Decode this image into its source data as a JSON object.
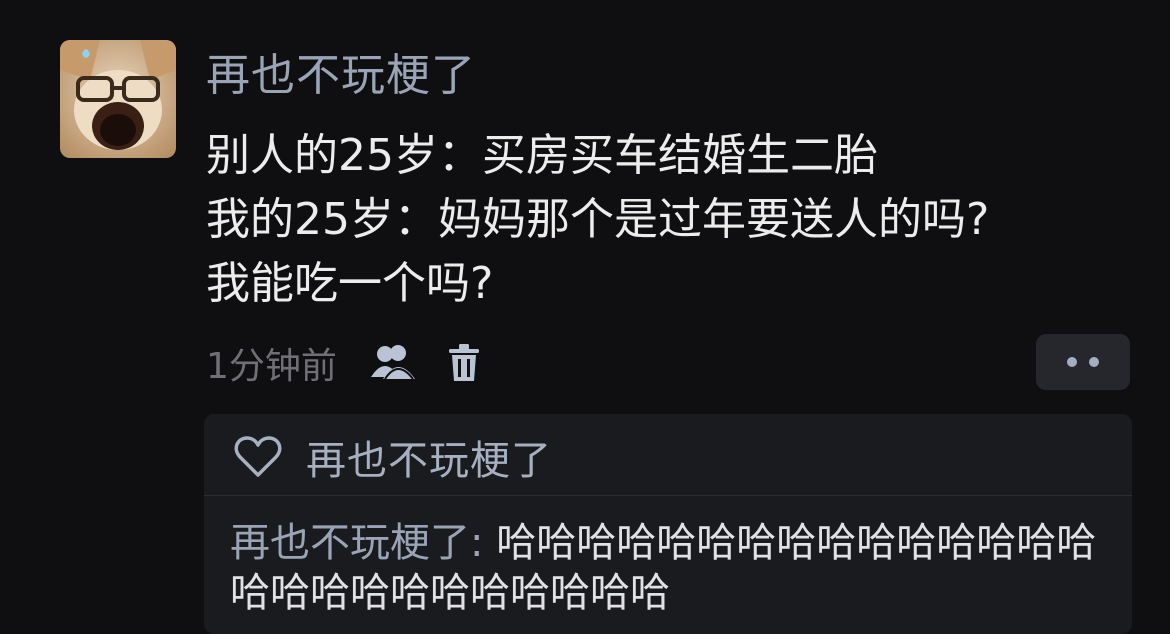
{
  "post": {
    "username": "再也不玩梗了",
    "lines": [
      "别人的25岁：买房买车结婚生二胎",
      "我的25岁：妈妈那个是过年要送人的吗?",
      "我能吃一个吗?"
    ],
    "time": "1分钟前"
  },
  "actions": {
    "user_icon": "user-icon",
    "delete_icon": "trash-icon",
    "more_icon": "more-dots-icon"
  },
  "reply": {
    "likes_icon": "heart-icon",
    "liked_by": "再也不玩梗了",
    "author": "再也不玩梗了:",
    "text": " 哈哈哈哈哈哈哈哈哈哈哈哈哈哈哈哈哈哈哈哈哈哈哈哈哈哈"
  },
  "colors": {
    "background": "#0f0f11",
    "username": "#9aa4b6",
    "reply_box": "#1a1b1f"
  }
}
